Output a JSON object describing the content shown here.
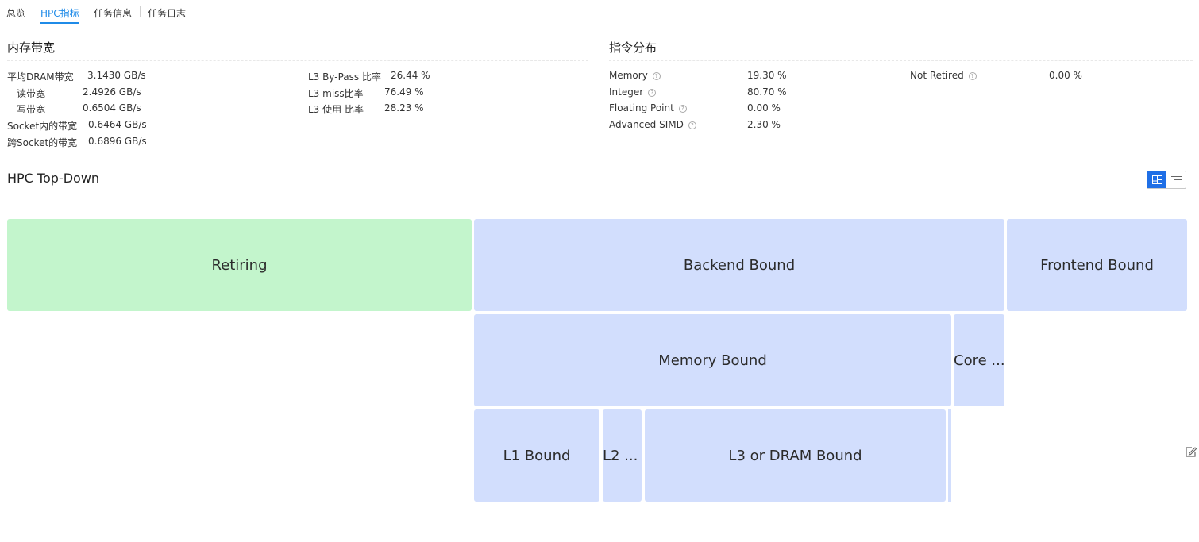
{
  "tabs": [
    {
      "label": "总览",
      "active": false
    },
    {
      "label": "HPC指标",
      "active": true
    },
    {
      "label": "任务信息",
      "active": false
    },
    {
      "label": "任务日志",
      "active": false
    }
  ],
  "memory_bandwidth": {
    "title": "内存带宽",
    "rows": [
      {
        "label": "平均DRAM带宽",
        "value": "3.1430 GB/s"
      },
      {
        "label": "读带宽",
        "value": "2.4926 GB/s"
      },
      {
        "label": "写带宽",
        "value": "0.6504 GB/s"
      },
      {
        "label": "Socket内的带宽",
        "value": "0.6464 GB/s"
      },
      {
        "label": "跨Socket的带宽",
        "value": "0.6896 GB/s"
      }
    ],
    "l3_rows": [
      {
        "label": "L3 By-Pass 比率",
        "value": "26.44 %"
      },
      {
        "label": "L3 miss比率",
        "value": "76.49 %"
      },
      {
        "label": "L3 使用 比率",
        "value": "28.23 %"
      }
    ]
  },
  "instruction_distribution": {
    "title": "指令分布",
    "rows": [
      {
        "label": "Memory",
        "value": "19.30 %"
      },
      {
        "label": "Integer",
        "value": "80.70 %"
      },
      {
        "label": "Floating Point",
        "value": "0.00 %"
      },
      {
        "label": "Advanced SIMD",
        "value": "2.30 %"
      }
    ],
    "extra_rows": [
      {
        "label": "Not Retired",
        "value": "0.00 %"
      }
    ]
  },
  "topdown": {
    "title": "HPC Top-Down",
    "view_mode": "treemap",
    "nodes": {
      "retiring": "Retiring",
      "backend_bound": "Backend Bound",
      "frontend_bound": "Frontend Bound",
      "memory_bound": "Memory Bound",
      "core_bound": "Core ...",
      "l1_bound": "L1 Bound",
      "l2_bound": "L2 ...",
      "l3_dram_bound": "L3 or DRAM Bound"
    },
    "colors": {
      "retiring": "#c3f5cc",
      "bound": "#d2defd",
      "accent": "#1f6fe6"
    }
  }
}
